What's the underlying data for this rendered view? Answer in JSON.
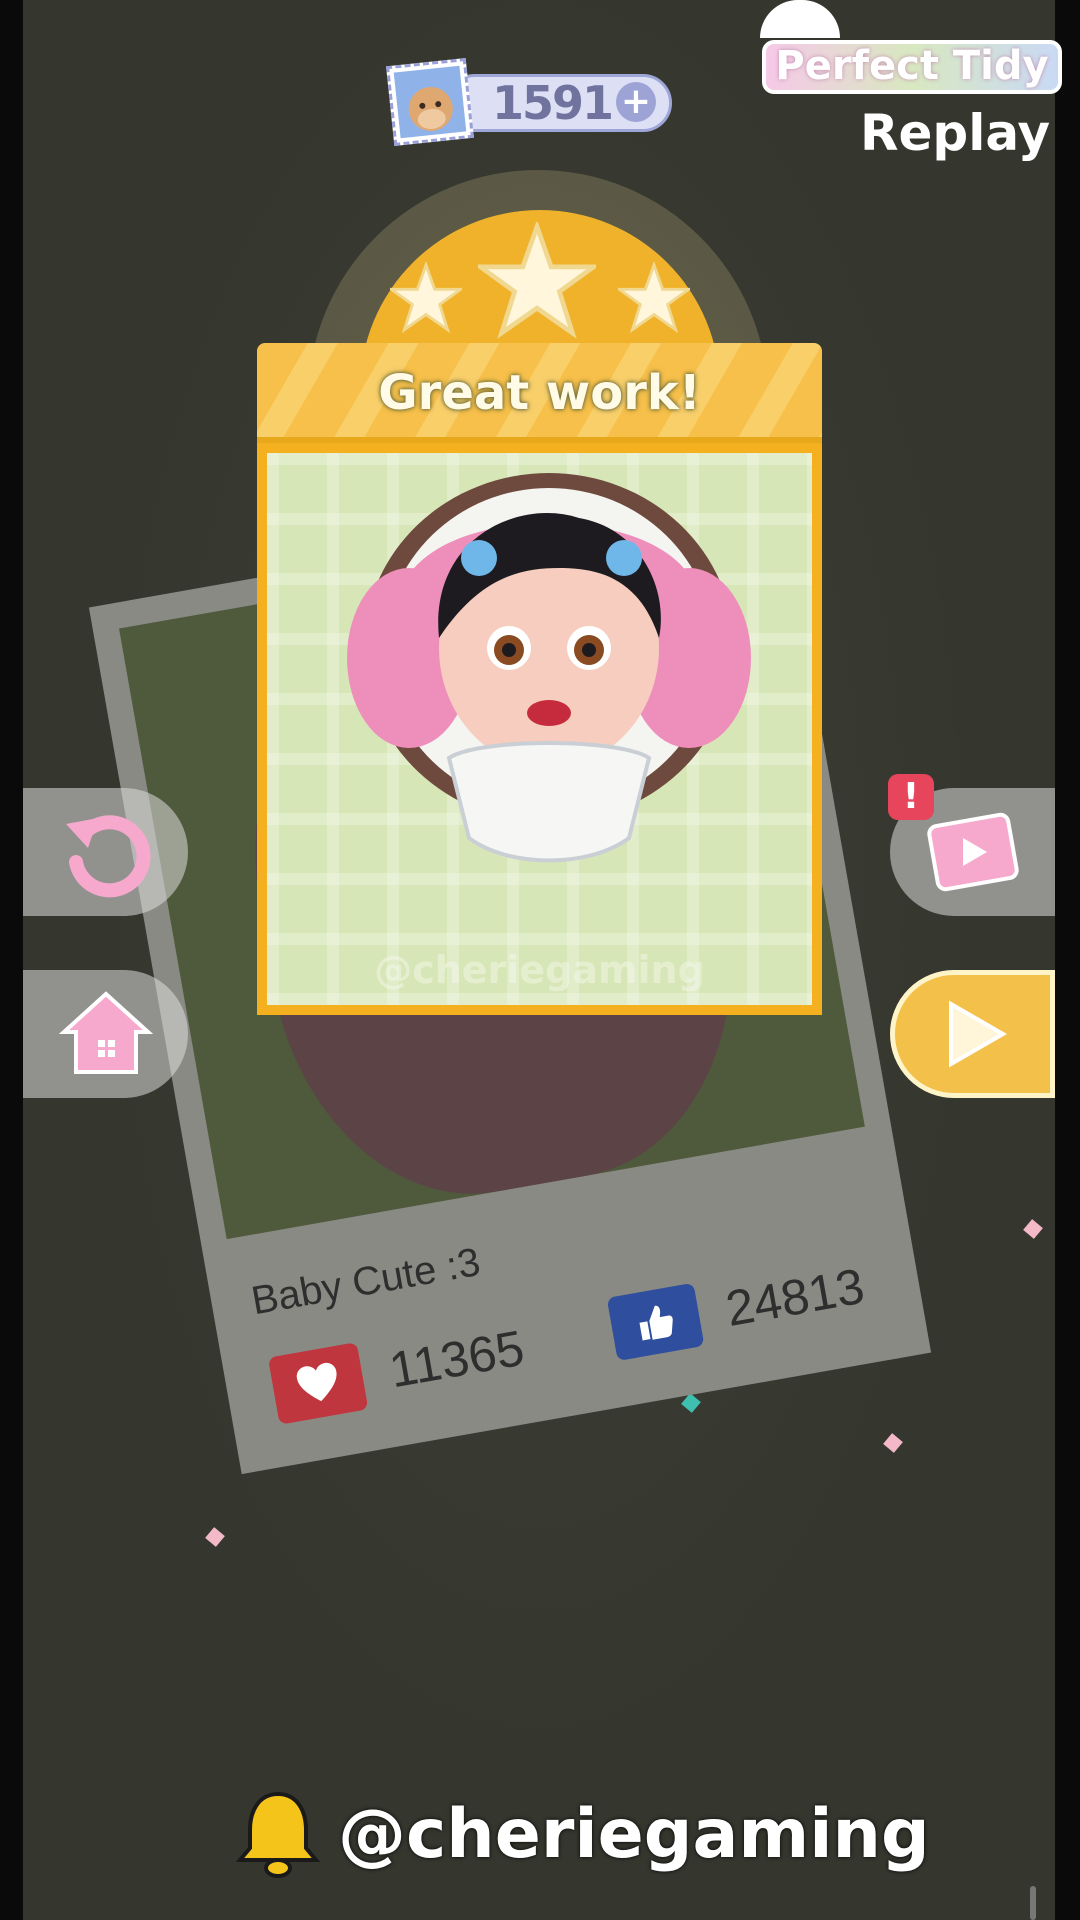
{
  "currency": {
    "value": "1591",
    "plus_label": "+"
  },
  "branding": {
    "title": "Perfect Tidy",
    "subtitle": "Replay"
  },
  "result": {
    "title": "Great work!",
    "stars_earned": 3,
    "stars_total": 3,
    "watermark": "@cheriegaming"
  },
  "background_card": {
    "title": "Baby Cute :3",
    "hearts": "11365",
    "likes": "24813"
  },
  "alert_badge": "!",
  "footer": {
    "handle": "@cheriegaming",
    "icon": "bell-icon"
  },
  "colors": {
    "accent": "#f5b01f",
    "heart": "#c0363e",
    "like": "#2f4f9e",
    "background": "#35372f"
  }
}
